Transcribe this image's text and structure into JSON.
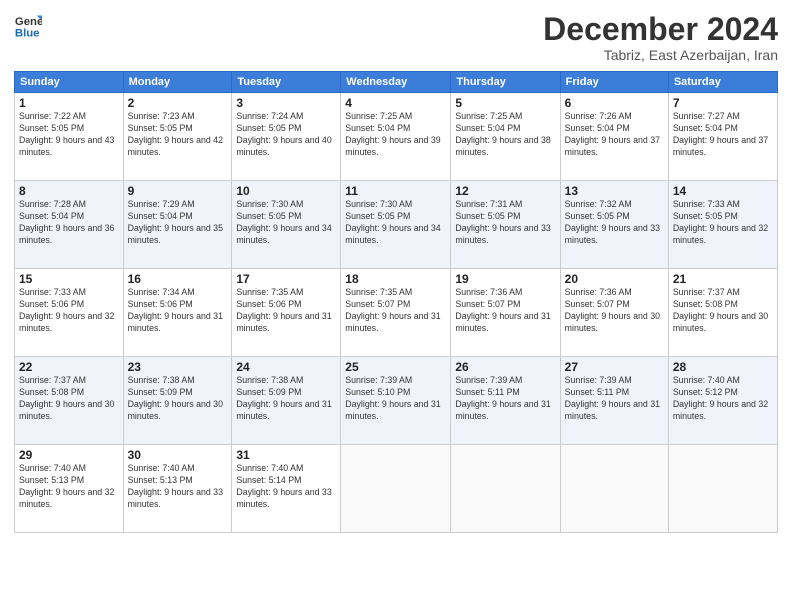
{
  "logo": {
    "line1": "General",
    "line2": "Blue"
  },
  "title": "December 2024",
  "subtitle": "Tabriz, East Azerbaijan, Iran",
  "weekdays": [
    "Sunday",
    "Monday",
    "Tuesday",
    "Wednesday",
    "Thursday",
    "Friday",
    "Saturday"
  ],
  "weeks": [
    [
      {
        "day": "1",
        "sunrise": "Sunrise: 7:22 AM",
        "sunset": "Sunset: 5:05 PM",
        "daylight": "Daylight: 9 hours and 43 minutes."
      },
      {
        "day": "2",
        "sunrise": "Sunrise: 7:23 AM",
        "sunset": "Sunset: 5:05 PM",
        "daylight": "Daylight: 9 hours and 42 minutes."
      },
      {
        "day": "3",
        "sunrise": "Sunrise: 7:24 AM",
        "sunset": "Sunset: 5:05 PM",
        "daylight": "Daylight: 9 hours and 40 minutes."
      },
      {
        "day": "4",
        "sunrise": "Sunrise: 7:25 AM",
        "sunset": "Sunset: 5:04 PM",
        "daylight": "Daylight: 9 hours and 39 minutes."
      },
      {
        "day": "5",
        "sunrise": "Sunrise: 7:25 AM",
        "sunset": "Sunset: 5:04 PM",
        "daylight": "Daylight: 9 hours and 38 minutes."
      },
      {
        "day": "6",
        "sunrise": "Sunrise: 7:26 AM",
        "sunset": "Sunset: 5:04 PM",
        "daylight": "Daylight: 9 hours and 37 minutes."
      },
      {
        "day": "7",
        "sunrise": "Sunrise: 7:27 AM",
        "sunset": "Sunset: 5:04 PM",
        "daylight": "Daylight: 9 hours and 37 minutes."
      }
    ],
    [
      {
        "day": "8",
        "sunrise": "Sunrise: 7:28 AM",
        "sunset": "Sunset: 5:04 PM",
        "daylight": "Daylight: 9 hours and 36 minutes."
      },
      {
        "day": "9",
        "sunrise": "Sunrise: 7:29 AM",
        "sunset": "Sunset: 5:04 PM",
        "daylight": "Daylight: 9 hours and 35 minutes."
      },
      {
        "day": "10",
        "sunrise": "Sunrise: 7:30 AM",
        "sunset": "Sunset: 5:05 PM",
        "daylight": "Daylight: 9 hours and 34 minutes."
      },
      {
        "day": "11",
        "sunrise": "Sunrise: 7:30 AM",
        "sunset": "Sunset: 5:05 PM",
        "daylight": "Daylight: 9 hours and 34 minutes."
      },
      {
        "day": "12",
        "sunrise": "Sunrise: 7:31 AM",
        "sunset": "Sunset: 5:05 PM",
        "daylight": "Daylight: 9 hours and 33 minutes."
      },
      {
        "day": "13",
        "sunrise": "Sunrise: 7:32 AM",
        "sunset": "Sunset: 5:05 PM",
        "daylight": "Daylight: 9 hours and 33 minutes."
      },
      {
        "day": "14",
        "sunrise": "Sunrise: 7:33 AM",
        "sunset": "Sunset: 5:05 PM",
        "daylight": "Daylight: 9 hours and 32 minutes."
      }
    ],
    [
      {
        "day": "15",
        "sunrise": "Sunrise: 7:33 AM",
        "sunset": "Sunset: 5:06 PM",
        "daylight": "Daylight: 9 hours and 32 minutes."
      },
      {
        "day": "16",
        "sunrise": "Sunrise: 7:34 AM",
        "sunset": "Sunset: 5:06 PM",
        "daylight": "Daylight: 9 hours and 31 minutes."
      },
      {
        "day": "17",
        "sunrise": "Sunrise: 7:35 AM",
        "sunset": "Sunset: 5:06 PM",
        "daylight": "Daylight: 9 hours and 31 minutes."
      },
      {
        "day": "18",
        "sunrise": "Sunrise: 7:35 AM",
        "sunset": "Sunset: 5:07 PM",
        "daylight": "Daylight: 9 hours and 31 minutes."
      },
      {
        "day": "19",
        "sunrise": "Sunrise: 7:36 AM",
        "sunset": "Sunset: 5:07 PM",
        "daylight": "Daylight: 9 hours and 31 minutes."
      },
      {
        "day": "20",
        "sunrise": "Sunrise: 7:36 AM",
        "sunset": "Sunset: 5:07 PM",
        "daylight": "Daylight: 9 hours and 30 minutes."
      },
      {
        "day": "21",
        "sunrise": "Sunrise: 7:37 AM",
        "sunset": "Sunset: 5:08 PM",
        "daylight": "Daylight: 9 hours and 30 minutes."
      }
    ],
    [
      {
        "day": "22",
        "sunrise": "Sunrise: 7:37 AM",
        "sunset": "Sunset: 5:08 PM",
        "daylight": "Daylight: 9 hours and 30 minutes."
      },
      {
        "day": "23",
        "sunrise": "Sunrise: 7:38 AM",
        "sunset": "Sunset: 5:09 PM",
        "daylight": "Daylight: 9 hours and 30 minutes."
      },
      {
        "day": "24",
        "sunrise": "Sunrise: 7:38 AM",
        "sunset": "Sunset: 5:09 PM",
        "daylight": "Daylight: 9 hours and 31 minutes."
      },
      {
        "day": "25",
        "sunrise": "Sunrise: 7:39 AM",
        "sunset": "Sunset: 5:10 PM",
        "daylight": "Daylight: 9 hours and 31 minutes."
      },
      {
        "day": "26",
        "sunrise": "Sunrise: 7:39 AM",
        "sunset": "Sunset: 5:11 PM",
        "daylight": "Daylight: 9 hours and 31 minutes."
      },
      {
        "day": "27",
        "sunrise": "Sunrise: 7:39 AM",
        "sunset": "Sunset: 5:11 PM",
        "daylight": "Daylight: 9 hours and 31 minutes."
      },
      {
        "day": "28",
        "sunrise": "Sunrise: 7:40 AM",
        "sunset": "Sunset: 5:12 PM",
        "daylight": "Daylight: 9 hours and 32 minutes."
      }
    ],
    [
      {
        "day": "29",
        "sunrise": "Sunrise: 7:40 AM",
        "sunset": "Sunset: 5:13 PM",
        "daylight": "Daylight: 9 hours and 32 minutes."
      },
      {
        "day": "30",
        "sunrise": "Sunrise: 7:40 AM",
        "sunset": "Sunset: 5:13 PM",
        "daylight": "Daylight: 9 hours and 33 minutes."
      },
      {
        "day": "31",
        "sunrise": "Sunrise: 7:40 AM",
        "sunset": "Sunset: 5:14 PM",
        "daylight": "Daylight: 9 hours and 33 minutes."
      },
      null,
      null,
      null,
      null
    ]
  ]
}
